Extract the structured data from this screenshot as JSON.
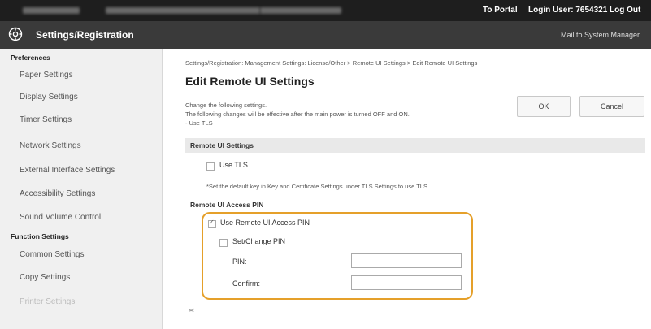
{
  "top_bar": {
    "portal_link": "To Portal",
    "login_text": "Login User:  7654321  Log Out"
  },
  "title_bar": {
    "app_title": "Settings/Registration",
    "mail_link": "Mail to System Manager"
  },
  "sidebar": {
    "preferences_heading": "Preferences",
    "preferences_items": [
      "Paper Settings",
      "Display Settings",
      "Timer Settings",
      "Network Settings",
      "External Interface Settings",
      "Accessibility Settings",
      "Sound Volume Control"
    ],
    "function_heading": "Function Settings",
    "function_items": [
      "Common Settings",
      "Copy Settings",
      "Printer Settings"
    ]
  },
  "main": {
    "breadcrumb": "Settings/Registration: Management Settings: License/Other > Remote UI Settings > Edit Remote UI Settings",
    "page_title": "Edit Remote UI Settings",
    "intro_line1": "Change the following settings.",
    "intro_line2": "The following changes will be effective after the main power is turned OFF and ON.",
    "intro_line3": "- Use TLS",
    "ok_label": "OK",
    "cancel_label": "Cancel",
    "remote_ui_settings_header": "Remote UI Settings",
    "use_tls_label": "Use TLS",
    "use_tls_checked": false,
    "tls_note": "*Set the default key in Key and Certificate Settings under TLS Settings to use TLS.",
    "pin_header": "Remote UI Access PIN",
    "use_pin_label": "Use Remote UI Access PIN",
    "use_pin_checked": true,
    "set_change_pin_label": "Set/Change PIN",
    "set_change_pin_checked": false,
    "pin_label": "PIN:",
    "pin_value": "",
    "confirm_label": "Confirm:",
    "confirm_value": "",
    "footer_glyph": "≍"
  },
  "colors": {
    "highlight_border": "#e5a02a",
    "top_bar_bg": "#1e1e1e",
    "title_bar_bg": "#3a3a3a"
  }
}
